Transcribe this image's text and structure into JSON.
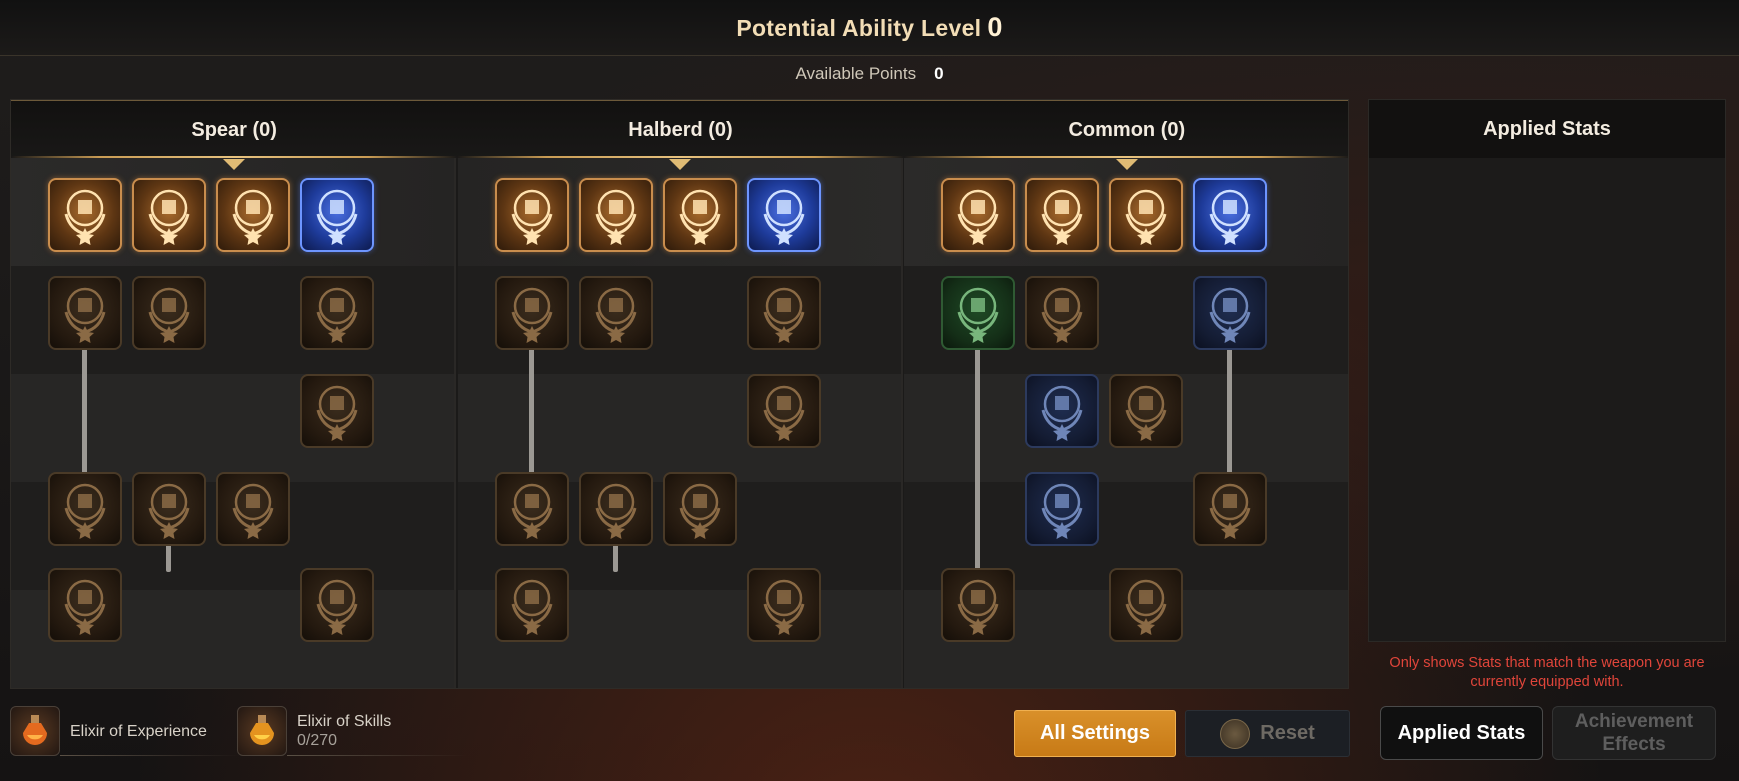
{
  "header": {
    "title": "Potential Ability Level",
    "level": "0"
  },
  "points": {
    "label": "Available Points",
    "value": "0"
  },
  "columns": [
    {
      "title": "Spear (0)"
    },
    {
      "title": "Halberd (0)"
    },
    {
      "title": "Common (0)"
    }
  ],
  "node_icons": {
    "spear": [
      "spear-crest-icon",
      "fist-icon",
      "gauntlet-icon",
      "shield-icon",
      "spear-flame-icon",
      "target-wheel-icon",
      "scope-icon",
      "potion-icon",
      "arrow-swirl-icon",
      "crosshair-icon",
      "spear-flame-icon",
      "shield-icon",
      "hammer-wheel-icon"
    ],
    "halberd": [
      "spear-crest-icon",
      "fist-icon",
      "gauntlet-icon",
      "shield-icon",
      "spear-flame-icon",
      "target-wheel-icon",
      "sword-flame-icon",
      "potion-icon",
      "arrow-swirl-icon",
      "crosshair-icon",
      "spear-flame-icon",
      "shield-icon",
      "hammer-wheel-icon"
    ],
    "common": [
      "spear-crest-icon",
      "no-target-icon",
      "gauntlet-icon",
      "shield-icon",
      "muscle-plus-icon",
      "fang-icon",
      "swirl-up-icon",
      "exp-icon",
      "gold-icon",
      "beast-icon",
      "no-sword-icon",
      "fist-icon",
      "potion-icon"
    ]
  },
  "applied_stats": {
    "title": "Applied Stats",
    "notice": "Only shows Stats that match the weapon you are currently equipped with."
  },
  "items": [
    {
      "name": "Elixir of Experience",
      "count": "",
      "icon": "elixir-bottle-icon"
    },
    {
      "name": "Elixir of Skills",
      "count": "0/270",
      "icon": "elixir-bottle-icon"
    }
  ],
  "buttons": {
    "all_settings": "All Settings",
    "reset": "Reset",
    "applied_stats": "Applied Stats",
    "achievement_effects": "Achievement Effects"
  },
  "colors": {
    "accent_gold": "#d9902a",
    "node_gold": "#c98d4d",
    "node_blue": "#6d95ff",
    "notice_red": "#e0453a"
  }
}
